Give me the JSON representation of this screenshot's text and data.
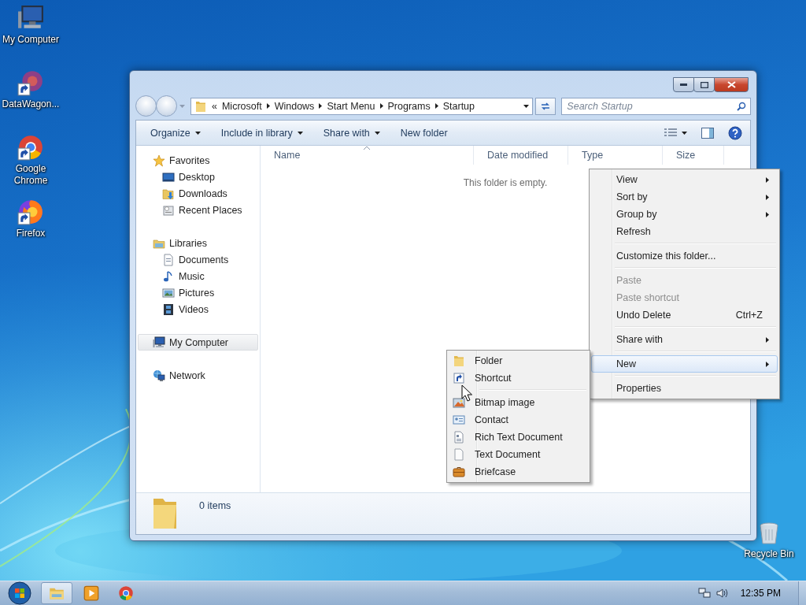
{
  "desktop_icons": [
    {
      "label": "My Computer",
      "kind": "computer"
    },
    {
      "label": "DataWagon...",
      "kind": "app"
    },
    {
      "label": "Google Chrome",
      "kind": "chrome"
    },
    {
      "label": "Firefox",
      "kind": "firefox"
    }
  ],
  "recycle_bin": {
    "label": "Recycle Bin"
  },
  "window": {
    "address": {
      "overflow": "«",
      "crumbs": [
        "Microsoft",
        "Windows",
        "Start Menu",
        "Programs",
        "Startup"
      ]
    },
    "search": {
      "placeholder": "Search Startup"
    },
    "toolbar": [
      {
        "label": "Organize",
        "dropdown": true
      },
      {
        "label": "Include in library",
        "dropdown": true
      },
      {
        "label": "Share with",
        "dropdown": true
      },
      {
        "label": "New folder",
        "dropdown": false
      }
    ],
    "navigation": [
      {
        "label": "Favorites",
        "kind": "star",
        "selected": false,
        "children": [
          {
            "label": "Desktop",
            "kind": "desktop",
            "selected": false
          },
          {
            "label": "Downloads",
            "kind": "downloads",
            "selected": false
          },
          {
            "label": "Recent Places",
            "kind": "recent",
            "selected": false
          }
        ]
      },
      {
        "label": "Libraries",
        "kind": "library",
        "selected": false,
        "children": [
          {
            "label": "Documents",
            "kind": "documents",
            "selected": false
          },
          {
            "label": "Music",
            "kind": "music",
            "selected": false
          },
          {
            "label": "Pictures",
            "kind": "pictures",
            "selected": false
          },
          {
            "label": "Videos",
            "kind": "videos",
            "selected": false
          }
        ]
      },
      {
        "label": "My Computer",
        "kind": "computer",
        "selected": true
      },
      {
        "label": "Network",
        "kind": "network",
        "selected": false
      }
    ],
    "columns": [
      {
        "label": "Name",
        "sorted": true
      },
      {
        "label": "Date modified",
        "sorted": false
      },
      {
        "label": "Type",
        "sorted": false
      },
      {
        "label": "Size",
        "sorted": false
      }
    ],
    "empty_message": "This folder is empty.",
    "status": "0 items"
  },
  "context_menu": {
    "groups": [
      {
        "items": [
          {
            "label": "View",
            "submenu": true,
            "disabled": false,
            "selected": false
          },
          {
            "label": "Sort by",
            "submenu": true,
            "disabled": false,
            "selected": false
          },
          {
            "label": "Group by",
            "submenu": true,
            "disabled": false,
            "selected": false
          },
          {
            "label": "Refresh",
            "submenu": false,
            "disabled": false,
            "selected": false
          }
        ]
      },
      {
        "items": [
          {
            "label": "Customize this folder...",
            "submenu": false,
            "disabled": false,
            "selected": false
          }
        ]
      },
      {
        "items": [
          {
            "label": "Paste",
            "submenu": false,
            "disabled": true,
            "selected": false
          },
          {
            "label": "Paste shortcut",
            "submenu": false,
            "disabled": true,
            "selected": false
          },
          {
            "label": "Undo Delete",
            "shortcut": "Ctrl+Z",
            "submenu": false,
            "disabled": false,
            "selected": false
          }
        ]
      },
      {
        "items": [
          {
            "label": "Share with",
            "submenu": true,
            "disabled": false,
            "selected": false
          }
        ]
      },
      {
        "items": [
          {
            "label": "New",
            "submenu": true,
            "disabled": false,
            "selected": true
          }
        ]
      },
      {
        "items": [
          {
            "label": "Properties",
            "submenu": false,
            "disabled": false,
            "selected": false
          }
        ]
      }
    ]
  },
  "new_submenu": {
    "groups": [
      {
        "items": [
          {
            "label": "Folder",
            "kind": "folder"
          },
          {
            "label": "Shortcut",
            "kind": "shortcut"
          }
        ]
      },
      {
        "items": [
          {
            "label": "Bitmap image",
            "kind": "bitmap"
          },
          {
            "label": "Contact",
            "kind": "contact"
          },
          {
            "label": "Rich Text Document",
            "kind": "rtf"
          },
          {
            "label": "Text Document",
            "kind": "text"
          },
          {
            "label": "Briefcase",
            "kind": "briefcase"
          }
        ]
      }
    ]
  },
  "taskbar": {
    "buttons": [
      {
        "kind": "explorer",
        "active": true
      },
      {
        "kind": "media",
        "active": false
      },
      {
        "kind": "chrome",
        "active": false
      }
    ],
    "clock": "12:35 PM"
  }
}
